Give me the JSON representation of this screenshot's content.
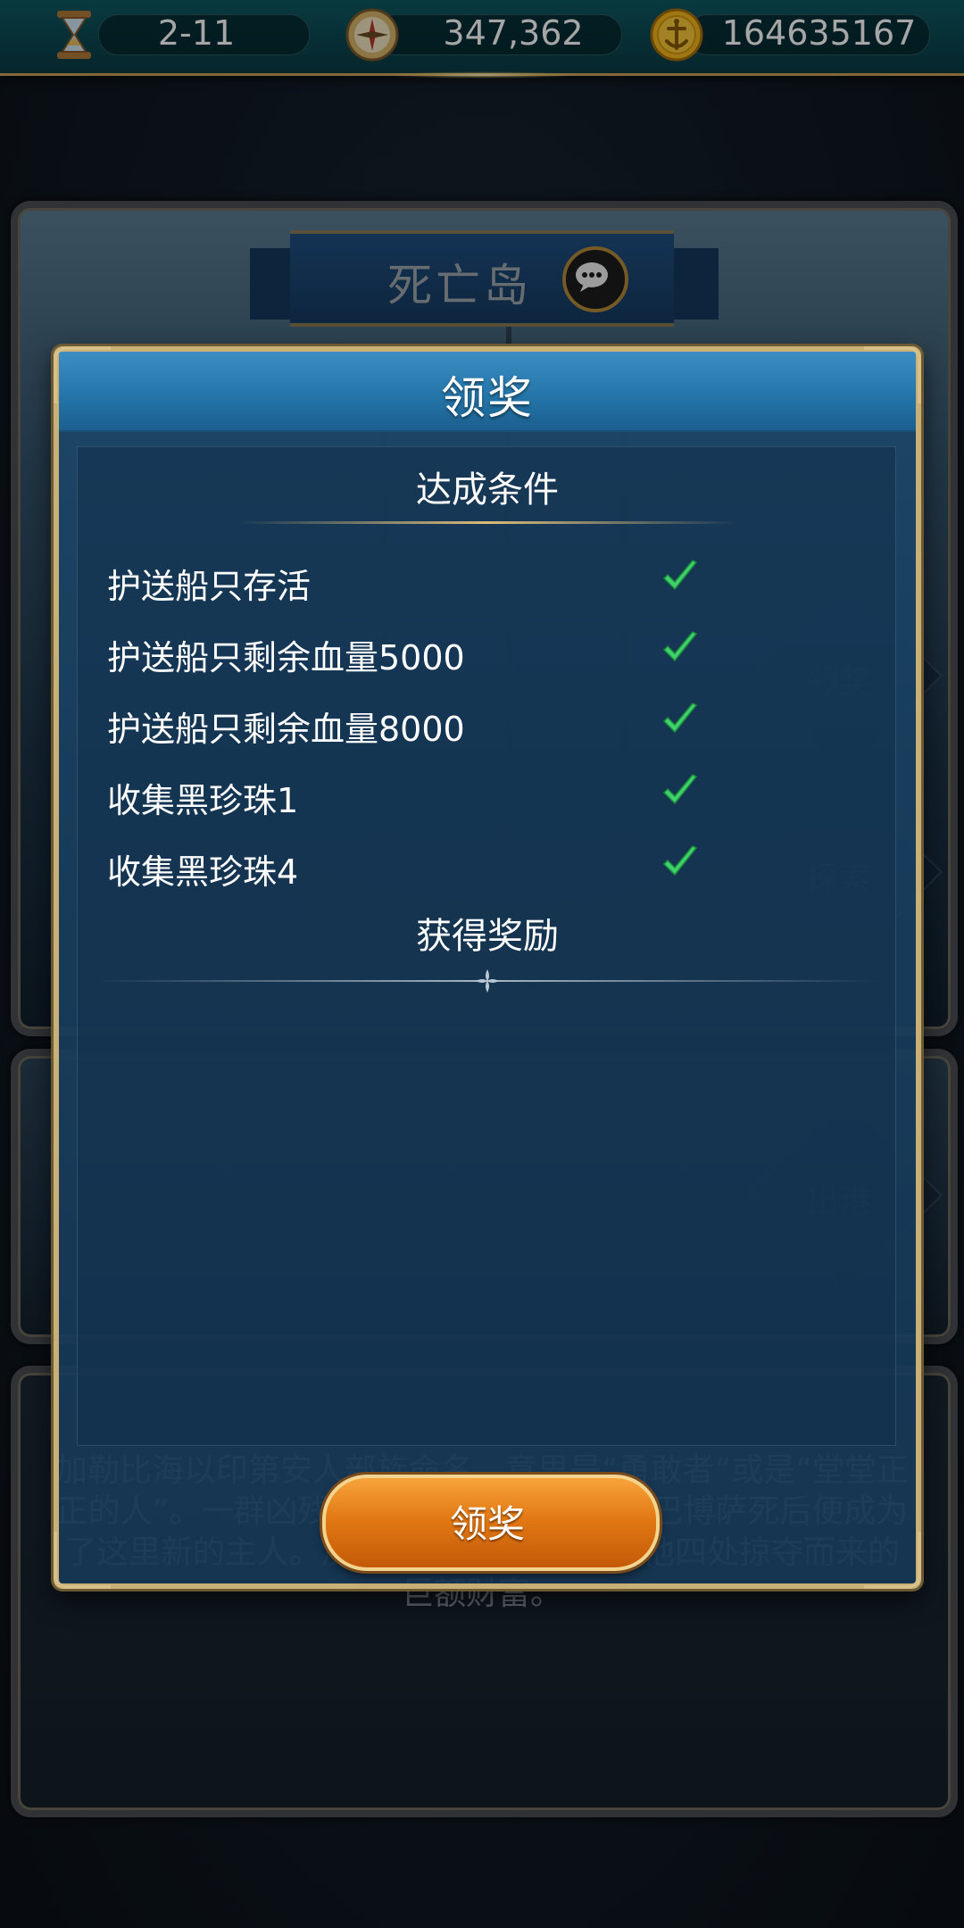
{
  "topbar": {
    "stage": "2-11",
    "compass_value": "347,362",
    "gold_value": "164635167",
    "icons": [
      "hourglass-icon",
      "compass-icon",
      "gold-anchor-coin-icon"
    ]
  },
  "background": {
    "stage_title": "死亡岛",
    "side_buttons": {
      "claim": "领奖",
      "explore": "探索",
      "depart": "出港"
    },
    "description": "加勒比海以印第安人部族命名，意思是“勇敢者”或是“堂堂正正的人”。一群凶残的海盗占岛作为据点，巴博萨死后便成为了这里新的主人。加勒比的死亡岛私藏了他四处掠夺而来的巨额财富。"
  },
  "dialog": {
    "title": "领奖",
    "conditions_title": "达成条件",
    "conditions": [
      {
        "label": "护送船只存活",
        "done": true
      },
      {
        "label": "护送船只剩余血量5000",
        "done": true
      },
      {
        "label": "护送船只剩余血量8000",
        "done": true
      },
      {
        "label": "收集黑珍珠1",
        "done": true
      },
      {
        "label": "收集黑珍珠4",
        "done": true
      }
    ],
    "rewards_title": "获得奖励",
    "claim_button": "领奖"
  },
  "colors": {
    "check_green": "#3ed26a",
    "button_orange": "#e27914",
    "frame_gold": "#c9b077"
  }
}
